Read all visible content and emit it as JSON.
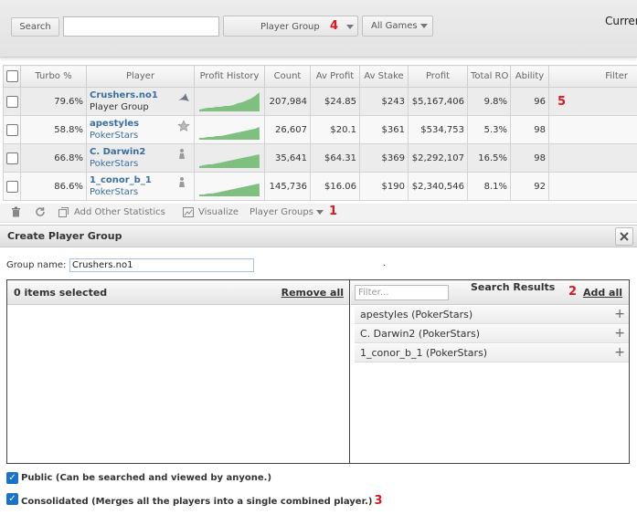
{
  "toolbar": {
    "search_button": "Search",
    "search_value": "",
    "player_group_label": "Player Group",
    "player_group_badge": "4",
    "all_games_label": "All Games",
    "current_label": "Curren"
  },
  "table": {
    "headers": [
      "Turbo %",
      "Player",
      "Profit History",
      "Count",
      "Av Profit",
      "Av Stake",
      "Profit",
      "Total RO",
      "Ability",
      "Filter"
    ],
    "rows": [
      {
        "turbo": "79.6%",
        "name": "Crushers.no1",
        "site": "Player Group",
        "icon": "shark-icon",
        "count": "207,984",
        "av_profit": "$24.85",
        "av_stake": "$243",
        "profit": "$5,167,406",
        "roi": "9.8%",
        "ability": "96",
        "badge": "5"
      },
      {
        "turbo": "58.8%",
        "name": "apestyles",
        "site": "PokerStars",
        "icon": "star-icon",
        "count": "26,607",
        "av_profit": "$20.1",
        "av_stake": "$361",
        "profit": "$534,753",
        "roi": "5.3%",
        "ability": "98"
      },
      {
        "turbo": "66.8%",
        "name": "C. Darwin2",
        "site": "PokerStars",
        "icon": "chess-piece-icon",
        "count": "35,641",
        "av_profit": "$64.31",
        "av_stake": "$369",
        "profit": "$2,292,107",
        "roi": "16.5%",
        "ability": "98"
      },
      {
        "turbo": "86.6%",
        "name": "1_conor_b_1",
        "site": "PokerStars",
        "icon": "chess-piece-icon",
        "count": "145,736",
        "av_profit": "$16.06",
        "av_stake": "$190",
        "profit": "$2,340,546",
        "roi": "8.1%",
        "ability": "92"
      }
    ]
  },
  "footer_bar": {
    "add_stats": "Add Other Statistics",
    "visualize": "Visualize",
    "player_groups": "Player Groups",
    "badge": "1"
  },
  "dialog": {
    "title": "Create Player Group",
    "group_name_label": "Group name:",
    "group_name_value": "Crushers.no1",
    "dot": ".",
    "items_selected": "0 items selected",
    "remove_all": "Remove all",
    "filter_placeholder": "Filter...",
    "search_results_title": "Search Results",
    "search_badge": "2",
    "add_all": "Add all",
    "results": [
      "apestyles (PokerStars)",
      "C. Darwin2 (PokerStars)",
      "1_conor_b_1 (PokerStars)"
    ],
    "public_label": "Public (Can be searched and viewed by anyone.)",
    "consolidated_label": "Consolidated (Merges all the players into a single combined player.)",
    "consolidated_badge": "3"
  },
  "colors": {
    "accent": "#3b6f9e",
    "annotation": "#d9191f",
    "chart_fill": "#7fbf7f",
    "checkbox": "#1a73c9"
  }
}
